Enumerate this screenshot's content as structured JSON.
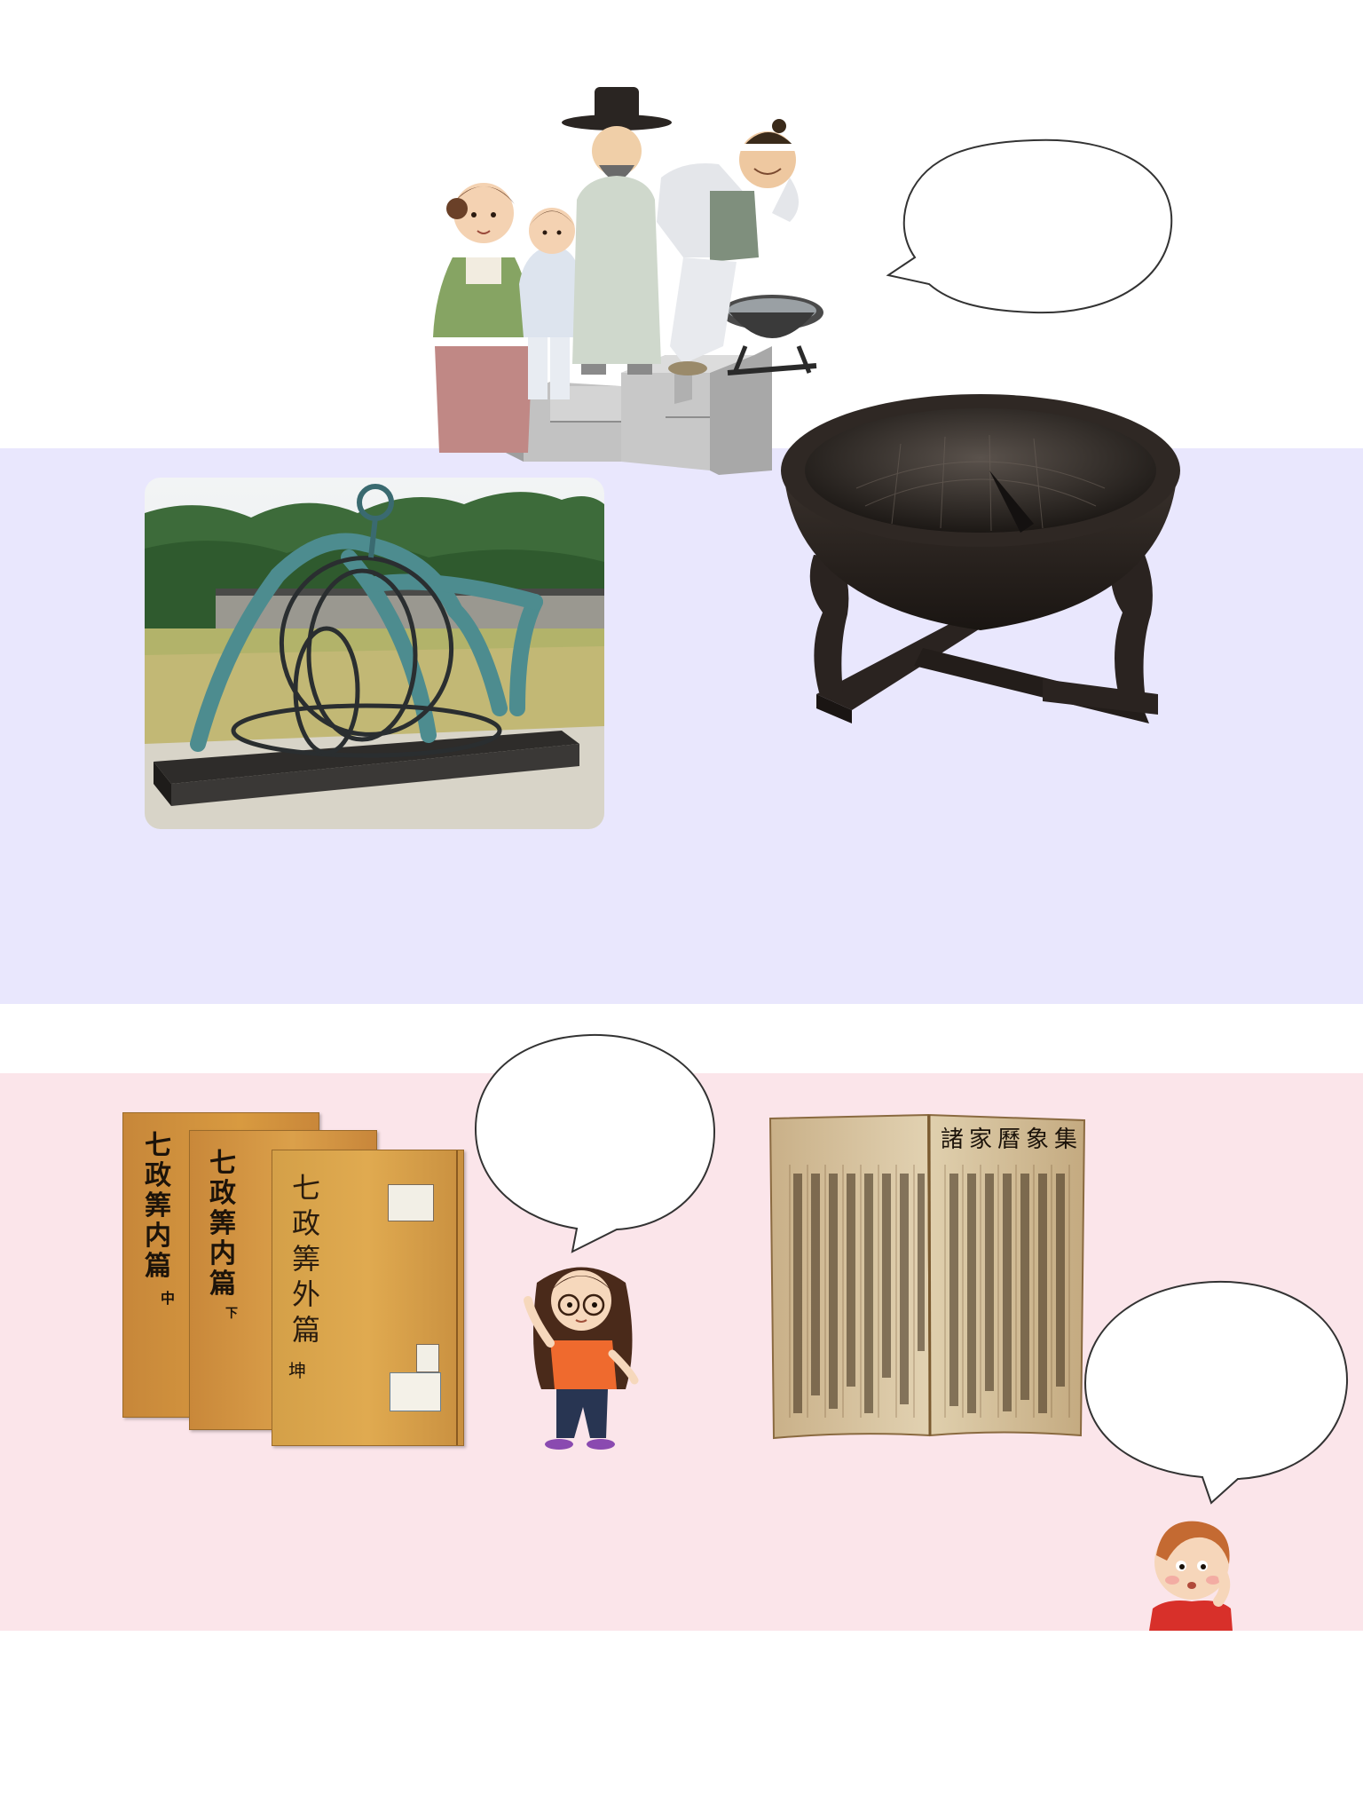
{
  "colors": {
    "lavender_band": "#e9e7fd",
    "pink_band": "#fbe5ea",
    "page_background": "#ffffff",
    "bronze": "#2e2723",
    "patina": "#4d8c8f",
    "book_cover": "#d09a3c",
    "old_paper": "#d8c6a3"
  },
  "books": {
    "book1": {
      "title": "七政筭内篇",
      "volume": "中"
    },
    "book2": {
      "title": "七政筭内篇",
      "volume": "下"
    },
    "book3": {
      "title": "七政筭外篇",
      "volume": "坤"
    }
  },
  "open_book": {
    "heading": "諸家曆象集"
  },
  "speech_bubbles": [
    {
      "id": "bubble-top-right",
      "text": ""
    },
    {
      "id": "bubble-girl",
      "text": ""
    },
    {
      "id": "bubble-boy",
      "text": ""
    }
  ]
}
